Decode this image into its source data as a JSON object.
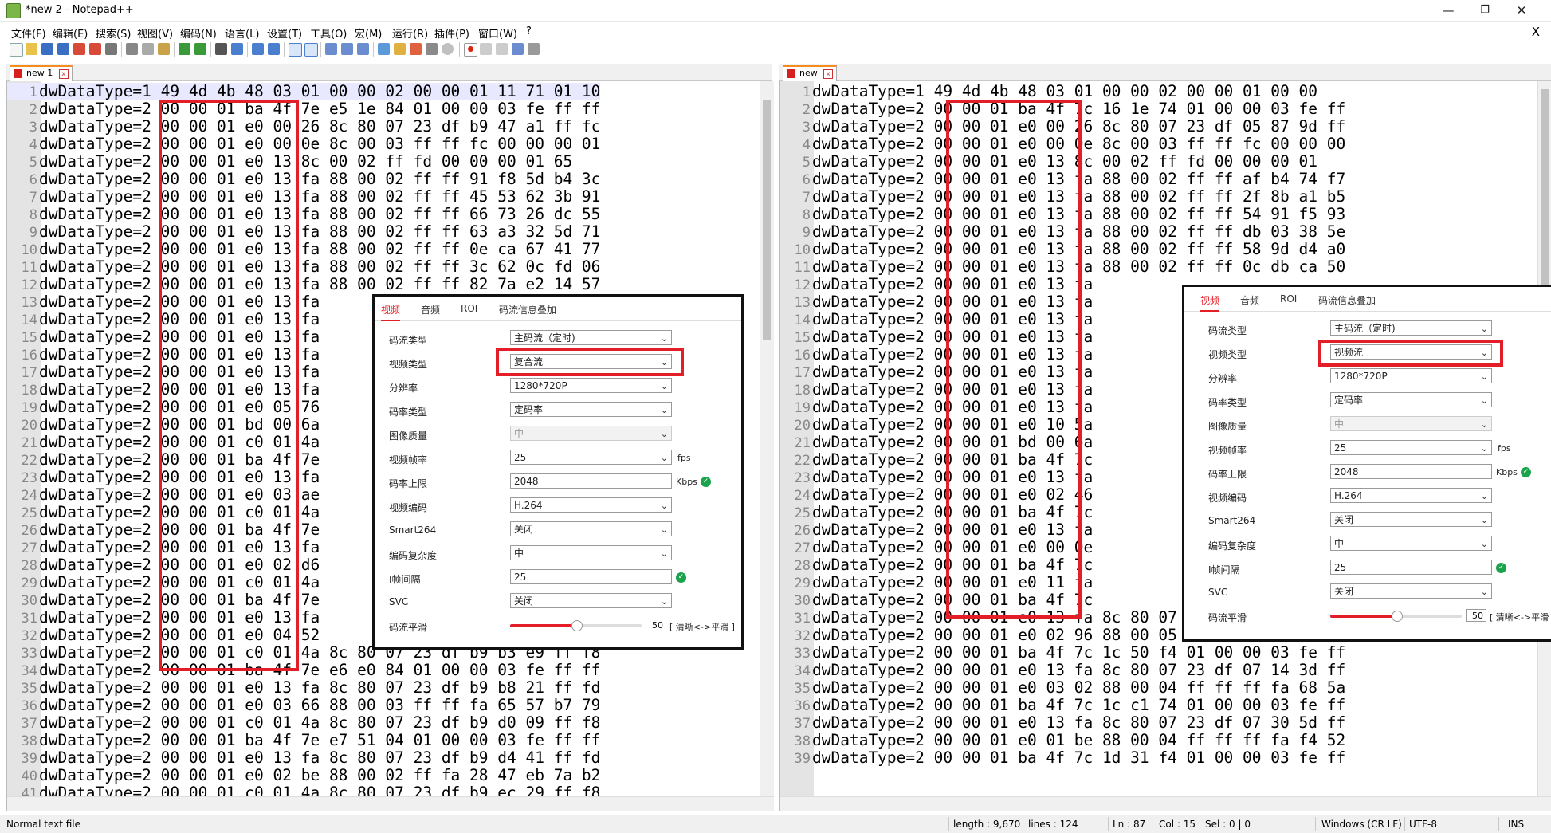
{
  "window": {
    "title": "*new 2 - Notepad++",
    "minimize": "—",
    "maximize": "❐",
    "close": "✕"
  },
  "menu": {
    "items": [
      "文件(F)",
      "编辑(E)",
      "搜索(S)",
      "视图(V)",
      "编码(N)",
      "语言(L)",
      "设置(T)",
      "工具(O)",
      "宏(M)",
      "运行(R)",
      "插件(P)",
      "窗口(W)",
      "?"
    ],
    "close_x": "X"
  },
  "tabs": {
    "left": {
      "label": "new 1",
      "close": "x"
    },
    "right": {
      "label": "new",
      "close": "x"
    }
  },
  "left_editor": {
    "current_line": 1,
    "lines": [
      "dwDataType=1  49  4d  4b  48  03  01  00  00  02  00  00  01  11  71  01  10",
      "dwDataType=2  00  00  01  ba  4f  7e  e5  1e  84  01  00  00  03  fe  ff  ff",
      "dwDataType=2  00  00  01  e0  00  26  8c  80  07  23  df  b9  47  a1  ff  fc",
      "dwDataType=2  00  00  01  e0  00  0e  8c  00  03  ff  ff  fc  00  00  00  01",
      "dwDataType=2  00  00  01  e0  13  8c  00  02  ff  fd  00  00  00  01  65",
      "dwDataType=2  00  00  01  e0  13  fa  88  00  02  ff  ff  91  f8  5d  b4  3c",
      "dwDataType=2  00  00  01  e0  13  fa  88  00  02  ff  ff  45  53  62  3b  91",
      "dwDataType=2  00  00  01  e0  13  fa  88  00  02  ff  ff  66  73  26  dc  55",
      "dwDataType=2  00  00  01  e0  13  fa  88  00  02  ff  ff  63  a3  32  5d  71",
      "dwDataType=2  00  00  01  e0  13  fa  88  00  02  ff  ff  0e  ca  67  41  77",
      "dwDataType=2  00  00  01  e0  13  fa  88  00  02  ff  ff  3c  62  0c  fd  06",
      "dwDataType=2  00  00  01  e0  13  fa  88  00  02  ff  ff  82  7a  e2  14  57",
      "dwDataType=2  00  00  01  e0  13  fa",
      "dwDataType=2  00  00  01  e0  13  fa",
      "dwDataType=2  00  00  01  e0  13  fa",
      "dwDataType=2  00  00  01  e0  13  fa",
      "dwDataType=2  00  00  01  e0  13  fa",
      "dwDataType=2  00  00  01  e0  13  fa",
      "dwDataType=2  00  00  01  e0  05  76",
      "dwDataType=2  00  00  01  bd  00  6a",
      "dwDataType=2  00  00  01  c0  01  4a",
      "dwDataType=2  00  00  01  ba  4f  7e",
      "dwDataType=2  00  00  01  e0  13  fa",
      "dwDataType=2  00  00  01  e0  03  ae",
      "dwDataType=2  00  00  01  c0  01  4a",
      "dwDataType=2  00  00  01  ba  4f  7e",
      "dwDataType=2  00  00  01  e0  13  fa",
      "dwDataType=2  00  00  01  e0  02  d6",
      "dwDataType=2  00  00  01  c0  01  4a",
      "dwDataType=2  00  00  01  ba  4f  7e",
      "dwDataType=2  00  00  01  e0  13  fa",
      "dwDataType=2  00  00  01  e0  04  52",
      "dwDataType=2  00  00  01  c0  01  4a  8c  80  07  23  df  b9  b3  e9  ff  f8",
      "dwDataType=2  00  00  01  ba  4f  7e  e6  e0  84  01  00  00  03  fe  ff  ff",
      "dwDataType=2  00  00  01  e0  13  fa  8c  80  07  23  df  b9  b8  21  ff  fd",
      "dwDataType=2  00  00  01  e0  03  66  88  00  03  ff  ff  fa  65  57  b7  79",
      "dwDataType=2  00  00  01  c0  01  4a  8c  80  07  23  df  b9  d0  09  ff  f8",
      "dwDataType=2  00  00  01  ba  4f  7e  e7  51  04  01  00  00  03  fe  ff  ff",
      "dwDataType=2  00  00  01  e0  13  fa  8c  80  07  23  df  b9  d4  41  ff  fd",
      "dwDataType=2  00  00  01  e0  02  be  88  00  02  ff  fa  28  47  eb  7a  b2",
      "dwDataType=2  00  00  01  c0  01  4a  8c  80  07  23  df  b9  ec  29  ff  f8"
    ]
  },
  "right_editor": {
    "lines": [
      "dwDataType=1  49  4d  4b  48  03  01  00  00  02  00  00  01  00  00",
      "dwDataType=2  00  00  01  ba  4f  7c  16  1e  74  01  00  00  03  fe  ff",
      "dwDataType=2  00  00  01  e0  00  26  8c  80  07  23  df  05  87  9d  ff",
      "dwDataType=2  00  00  01  e0  00  0e  8c  00  03  ff  ff  fc  00  00  00",
      "dwDataType=2  00  00  01  e0  13  8c  00  02  ff  fd  00  00  00  01",
      "dwDataType=2  00  00  01  e0  13  fa  88  00  02  ff  ff  af  b4  74  f7",
      "dwDataType=2  00  00  01  e0  13  fa  88  00  02  ff  ff  2f  8b  a1  b5",
      "dwDataType=2  00  00  01  e0  13  fa  88  00  02  ff  ff  54  91  f5  93",
      "dwDataType=2  00  00  01  e0  13  fa  88  00  02  ff  ff  db  03  38  5e",
      "dwDataType=2  00  00  01  e0  13  fa  88  00  02  ff  ff  58  9d  d4  a0",
      "dwDataType=2  00  00  01  e0  13  fa  88  00  02  ff  ff  0c  db  ca  50",
      "dwDataType=2  00  00  01  e0  13  fa",
      "dwDataType=2  00  00  01  e0  13  fa",
      "dwDataType=2  00  00  01  e0  13  fa",
      "dwDataType=2  00  00  01  e0  13  fa",
      "dwDataType=2  00  00  01  e0  13  fa",
      "dwDataType=2  00  00  01  e0  13  fa",
      "dwDataType=2  00  00  01  e0  13  fa",
      "dwDataType=2  00  00  01  e0  13  fa",
      "dwDataType=2  00  00  01  e0  10  5a",
      "dwDataType=2  00  00  01  bd  00  6a",
      "dwDataType=2  00  00  01  ba  4f  7c",
      "dwDataType=2  00  00  01  e0  13  fa",
      "dwDataType=2  00  00  01  e0  02  46",
      "dwDataType=2  00  00  01  ba  4f  7c",
      "dwDataType=2  00  00  01  e0  13  fa",
      "dwDataType=2  00  00  01  e0  00  0e",
      "dwDataType=2  00  00  01  ba  4f  7c",
      "dwDataType=2  00  00  01  e0  11  fa",
      "dwDataType=2  00  00  01  ba  4f  7c",
      "dwDataType=2  00  00  01  e0  13  fa  8c  80  07  23  df  05  f8  1d  ff",
      "dwDataType=2  00  00  01  e0  02  96  88  00  05  ff  ff  ff  ff  fa  a7",
      "dwDataType=2  00  00  01  ba  4f  7c  1c  50  f4  01  00  00  03  fe  ff",
      "dwDataType=2  00  00  01  e0  13  fa  8c  80  07  23  df  07  14  3d  ff",
      "dwDataType=2  00  00  01  e0  03  02  88  00  04  ff  ff  ff  fa  68  5a",
      "dwDataType=2  00  00  01  ba  4f  7c  1c  c1  74  01  00  00  03  fe  ff",
      "dwDataType=2  00  00  01  e0  13  fa  8c  80  07  23  df  07  30  5d  ff",
      "dwDataType=2  00  00  01  e0  01  be  88  00  04  ff  ff  ff  fa  f4  52",
      "dwDataType=2  00  00  01  ba  4f  7c  1d  31  f4  01  00  00  03  fe  ff"
    ]
  },
  "left_panel": {
    "tabs": [
      "视频",
      "音频",
      "ROI",
      "码流信息叠加"
    ],
    "active_tab": "视频",
    "fields": {
      "stream_type": {
        "label": "码流类型",
        "value": "主码流（定时)"
      },
      "video_type": {
        "label": "视频类型",
        "value": "复合流"
      },
      "resolution": {
        "label": "分辨率",
        "value": "1280*720P"
      },
      "bitrate_type": {
        "label": "码率类型",
        "value": "定码率"
      },
      "image_quality": {
        "label": "图像质量",
        "value": "中"
      },
      "frame_rate": {
        "label": "视频帧率",
        "value": "25",
        "unit": "fps"
      },
      "max_bitrate": {
        "label": "码率上限",
        "value": "2048",
        "unit": "Kbps"
      },
      "video_encoding": {
        "label": "视频编码",
        "value": "H.264"
      },
      "smart264": {
        "label": "Smart264",
        "value": "关闭"
      },
      "complexity": {
        "label": "编码复杂度",
        "value": "中"
      },
      "i_frame_interval": {
        "label": "I帧间隔",
        "value": "25"
      },
      "svc": {
        "label": "SVC",
        "value": "关闭"
      },
      "smoothing": {
        "label": "码流平滑",
        "value": "50",
        "level": 0.5,
        "hint": "[ 清晰<->平滑 ]"
      }
    }
  },
  "right_panel": {
    "tabs": [
      "视频",
      "音频",
      "ROI",
      "码流信息叠加"
    ],
    "active_tab": "视频",
    "fields": {
      "stream_type": {
        "label": "码流类型",
        "value": "主码流（定时)"
      },
      "video_type": {
        "label": "视频类型",
        "value": "视频流"
      },
      "resolution": {
        "label": "分辨率",
        "value": "1280*720P"
      },
      "bitrate_type": {
        "label": "码率类型",
        "value": "定码率"
      },
      "image_quality": {
        "label": "图像质量",
        "value": "中"
      },
      "frame_rate": {
        "label": "视频帧率",
        "value": "25",
        "unit": "fps"
      },
      "max_bitrate": {
        "label": "码率上限",
        "value": "2048",
        "unit": "Kbps"
      },
      "video_encoding": {
        "label": "视频编码",
        "value": "H.264"
      },
      "smart264": {
        "label": "Smart264",
        "value": "关闭"
      },
      "complexity": {
        "label": "编码复杂度",
        "value": "中"
      },
      "i_frame_interval": {
        "label": "I帧间隔",
        "value": "25"
      },
      "svc": {
        "label": "SVC",
        "value": "关闭"
      },
      "smoothing": {
        "label": "码流平滑",
        "value": "50",
        "level": 0.5,
        "hint": "[ 清晰<->平滑 ]"
      }
    }
  },
  "statusbar": {
    "file_type": "Normal text file",
    "length": "length : 9,670",
    "lines": "lines : 124",
    "ln": "Ln : 87",
    "col": "Col : 15",
    "sel": "Sel : 0 | 0",
    "eol": "Windows (CR LF)",
    "encoding": "UTF-8",
    "mode": "INS"
  },
  "colors": {
    "accent_red": "#e41e26",
    "tab_orange": "#f58c1e",
    "ok_green": "#1aa34a"
  }
}
